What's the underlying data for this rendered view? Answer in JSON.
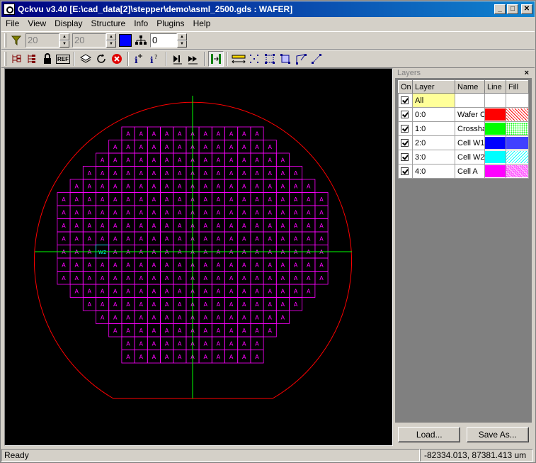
{
  "window": {
    "title": "Qckvu v3.40 [E:\\cad_data[2]\\stepper\\demo\\asml_2500.gds : WAFER]",
    "minimize_glyph": "_",
    "maximize_glyph": "□",
    "close_glyph": "✕"
  },
  "menu": [
    "File",
    "View",
    "Display",
    "Structure",
    "Info",
    "Plugins",
    "Help"
  ],
  "toolbar1": {
    "filter_min": "20",
    "filter_max": "20",
    "color": "#0000ff",
    "depth_value": "0"
  },
  "toolbar2": {
    "ref_label": "REF"
  },
  "layers_panel": {
    "title": "Layers",
    "close_glyph": "×",
    "headers": [
      "On",
      "Layer",
      "Name",
      "Line",
      "Fill"
    ],
    "rows": [
      {
        "layer": "All",
        "name": "",
        "color": "",
        "all": true
      },
      {
        "layer": "0:0",
        "name": "Wafer C",
        "color": "#ff0000"
      },
      {
        "layer": "1:0",
        "name": "Crossha",
        "color": "#00ff00"
      },
      {
        "layer": "2:0",
        "name": "Cell W1",
        "color": "#0000ff"
      },
      {
        "layer": "3:0",
        "name": "Cell W2",
        "color": "#00ffff"
      },
      {
        "layer": "4:0",
        "name": "Cell A",
        "color": "#ff00ff"
      }
    ],
    "load_label": "Load...",
    "save_label": "Save As..."
  },
  "wafer": {
    "row_counts": [
      11,
      13,
      15,
      17,
      19,
      21,
      21,
      21,
      21,
      21,
      21,
      21,
      19,
      17,
      15,
      13,
      11,
      11
    ],
    "cell_label": "A",
    "special_label": "W2",
    "wafer_color": "#ff0000",
    "cross_color": "#00ff00",
    "cell_color": "#ff00ff",
    "special_color": "#00ffff"
  },
  "status": {
    "message": "Ready",
    "coords": "-82334.013, 87381.413 um"
  }
}
